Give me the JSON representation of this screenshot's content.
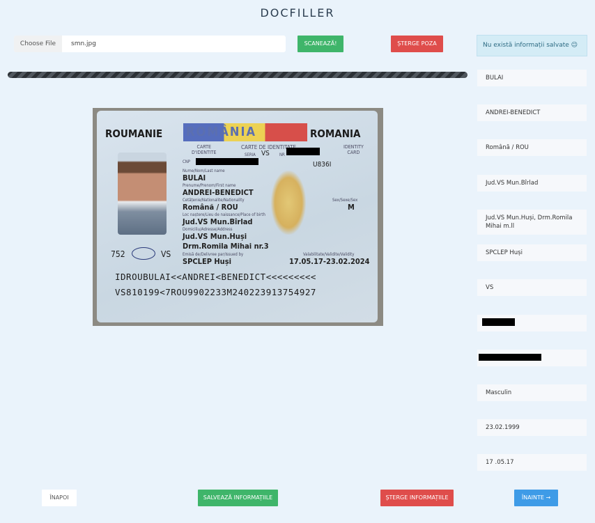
{
  "app_title": "DOCFILLER",
  "file_input": {
    "button_label": "Choose File",
    "file_name": "smn.jpg"
  },
  "buttons": {
    "scan": "SCANEAZĂ!",
    "delete_photo": "ȘTERGE POZA",
    "back": "ÎNAPOI",
    "save_info": "SALVEAZĂ INFORMAȚIILE",
    "delete_info": "ȘTERGE INFORMAȚIILE",
    "next": "ÎNAINTE →"
  },
  "info_message": "Nu există informații salvate 😉",
  "progress": {
    "percent": 100
  },
  "fields": {
    "last_name": "BULAI",
    "first_name": "ANDREI-BENEDICT",
    "nationality": "Română / ROU",
    "birth_place": "Jud.VS Mun.Bîrlad",
    "address": "Jud.VS Mun.Huși, Drm.Romila Mihai m.ll",
    "issued_by": "SPCLEP Huși",
    "series": "VS",
    "number": "",
    "cnp": "",
    "sex": "Masculin",
    "expiry": "23.02.1999",
    "issue_date": "17 .05.17"
  },
  "card": {
    "roumanie": "ROUMANIE",
    "romania_center": "ROMÂNIA",
    "romania_right": "ROMANIA",
    "carte_identite": "CARTE\nD'IDENTITE",
    "carte_de_identitate": "CARTE DE IDENTITATE",
    "seria_label": "SERIA",
    "seria": "VS",
    "nr_label": "NR",
    "identity_card": "IDENTITY\nCARD",
    "cnp_label": "CNP",
    "code": "U836I",
    "name_label": "Nume/Nom/Last name",
    "name": "BULAI",
    "prenume_label": "Prenume/Prenom/First name",
    "prenume": "ANDREI-BENEDICT",
    "cet_label": "Cetățenie/Nationalite/Nationality",
    "cet": "Română / ROU",
    "sex_label": "Sex/Sexe/Sex",
    "sex": "M",
    "loc_label": "Loc naștere/Lieu de naissance/Place of birth",
    "loc": "Jud.VS Mun.Bîrlad",
    "dom_label": "Domiciliu/Adresse/Address",
    "dom1": "Jud.VS Mun.Huși",
    "dom2": "Drm.Romila Mihai nr.3",
    "emisa_label": "Emisă de/Delivree par/Issued by",
    "emisa": "SPCLEP Huși",
    "valid_label": "Valabilitate/Validite/Validity",
    "valid": "17.05.17-23.02.2024",
    "num752": "752",
    "vs": "VS",
    "mrz1": "IDROUBULAI<<ANDREI<BENEDICT<<<<<<<<<",
    "mrz2": "VS810199<7ROU9902233M240223913754927"
  }
}
